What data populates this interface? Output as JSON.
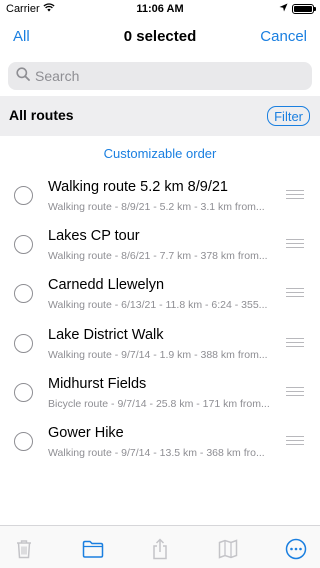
{
  "status": {
    "carrier": "Carrier",
    "time": "11:06 AM",
    "battery_level": 1.0,
    "icons": [
      "wifi-icon",
      "location-arrow-icon",
      "battery-icon"
    ]
  },
  "nav": {
    "left": "All",
    "title": "0 selected",
    "right": "Cancel"
  },
  "search": {
    "placeholder": "Search",
    "value": ""
  },
  "section": {
    "title": "All routes",
    "filter_label": "Filter"
  },
  "order_link": "Customizable order",
  "routes": [
    {
      "name": "Walking route 5.2 km 8/9/21",
      "detail": "Walking route - 8/9/21 - 5.2 km - 3.1 km from..."
    },
    {
      "name": "Lakes CP tour",
      "detail": "Walking route - 8/6/21 - 7.7 km - 378 km from..."
    },
    {
      "name": "Carnedd Llewelyn",
      "detail": "Walking route - 6/13/21 - 11.8 km - 6:24 - 355..."
    },
    {
      "name": "Lake District Walk",
      "detail": "Walking route - 9/7/14 - 1.9 km - 388 km from..."
    },
    {
      "name": "Midhurst Fields",
      "detail": "Bicycle route - 9/7/14 - 25.8 km - 171 km from..."
    },
    {
      "name": "Gower Hike",
      "detail": "Walking route - 9/7/14 - 13.5 km - 368 km fro..."
    }
  ],
  "toolbar": {
    "icons": [
      "trash-icon",
      "folder-icon",
      "share-icon",
      "map-icon",
      "more-icon"
    ],
    "disabled": [
      "trash-icon",
      "share-icon",
      "map-icon"
    ]
  },
  "colors": {
    "accent": "#1a7fe0",
    "secondary_text": "#8e8e93",
    "section_bg": "#eeeef0",
    "disabled_icon": "#c4c4c8"
  }
}
